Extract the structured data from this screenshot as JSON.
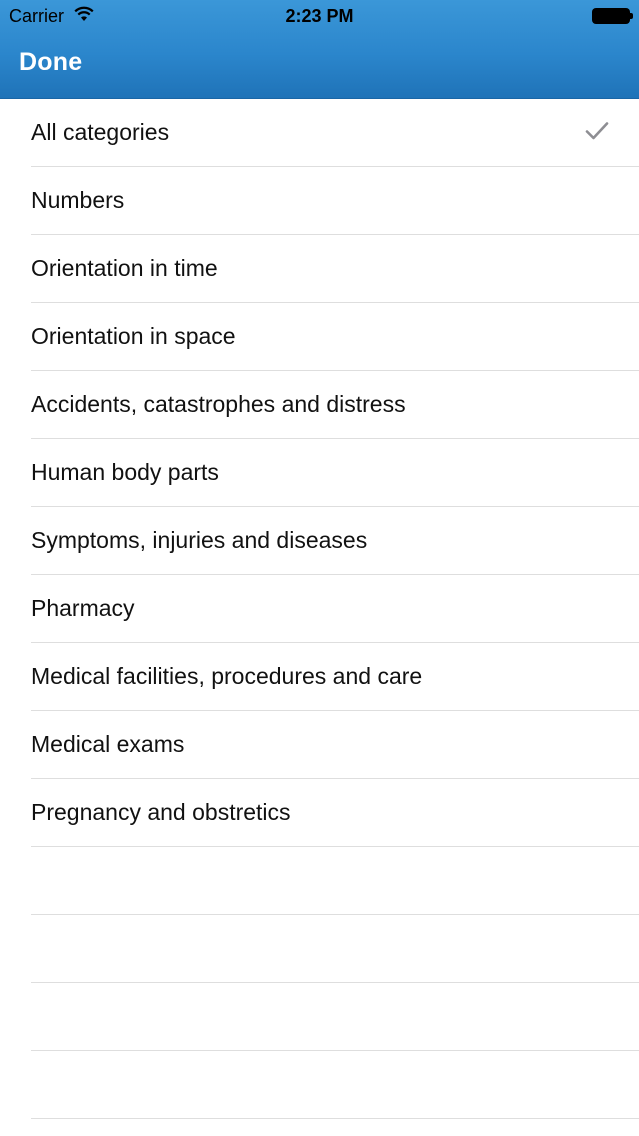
{
  "status_bar": {
    "carrier": "Carrier",
    "time": "2:23 PM",
    "wifi_icon": "wifi-icon",
    "battery_icon": "battery-icon"
  },
  "nav": {
    "done_label": "Done",
    "bar_color": "#2b86cc"
  },
  "categories": {
    "selected": "All categories",
    "items": [
      {
        "label": "All categories",
        "checked": true
      },
      {
        "label": "Numbers",
        "checked": false
      },
      {
        "label": "Orientation in time",
        "checked": false
      },
      {
        "label": "Orientation in space",
        "checked": false
      },
      {
        "label": "Accidents, catastrophes and distress",
        "checked": false
      },
      {
        "label": "Human body parts",
        "checked": false
      },
      {
        "label": "Symptoms, injuries and diseases",
        "checked": false
      },
      {
        "label": "Pharmacy",
        "checked": false
      },
      {
        "label": "Medical facilities, procedures and care",
        "checked": false
      },
      {
        "label": "Medical exams",
        "checked": false
      },
      {
        "label": "Pregnancy and obstretics",
        "checked": false
      }
    ],
    "empty_rows": 4,
    "check_icon": "checkmark-icon",
    "check_color": "#8e8e93"
  }
}
